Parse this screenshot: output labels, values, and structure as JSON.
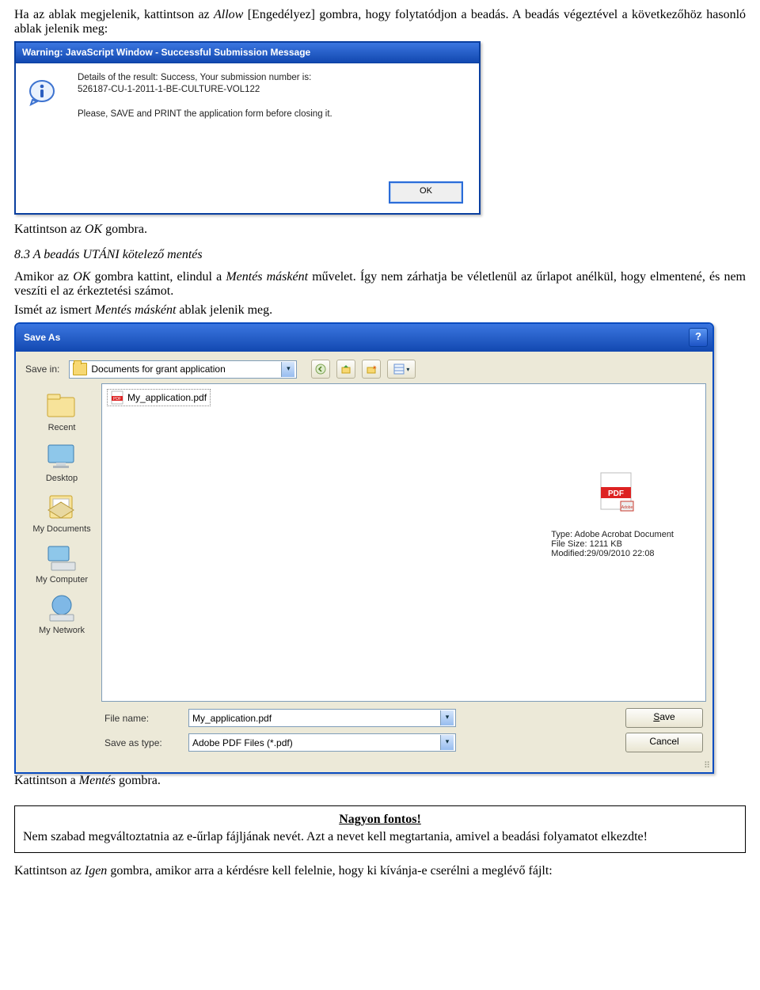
{
  "doc": {
    "p1a": "Ha az ablak megjelenik, kattintson az ",
    "p1b": "Allow",
    "p1c": " [Engedélyez] gombra, hogy folytatódjon a beadás. A beadás végeztével a következőhöz hasonló ablak jelenik meg:",
    "p2a": "Kattintson az ",
    "p2b": "OK",
    "p2c": " gombra.",
    "section": "8.3 A beadás UTÁNI kötelező mentés",
    "p3a": "Amikor az ",
    "p3b": "OK",
    "p3c": " gombra kattint, elindul a ",
    "p3d": "Mentés másként",
    "p3e": " művelet. Így nem zárhatja be véletlenül az űrlapot anélkül, hogy elmentené, és nem veszíti el az érkeztetési számot.",
    "p4a": "Ismét az ismert ",
    "p4b": "Mentés másként",
    "p4c": " ablak jelenik meg.",
    "p5a": "Kattintson a ",
    "p5b": "Mentés",
    "p5c": " gombra.",
    "noticeTitle": "Nagyon fontos!",
    "notice": "Nem szabad megváltoztatnia az e-űrlap fájljának nevét. Azt a nevet kell megtartania, amivel a beadási folyamatot elkezdte!",
    "p6a": "Kattintson az ",
    "p6b": "Igen",
    "p6c": " gombra, amikor arra a kérdésre kell felelnie, hogy ki kívánja-e cserélni a meglévő fájlt:"
  },
  "warn": {
    "title": "Warning: JavaScript Window - Successful Submission Message",
    "t1": "Details of the result: Success, Your submission number is:",
    "t2": "526187-CU-1-2011-1-BE-CULTURE-VOL122",
    "t3": "Please, SAVE and PRINT the application form before closing it.",
    "ok": "OK"
  },
  "saveas": {
    "title": "Save As",
    "help": "?",
    "saveInLabel": "Save in:",
    "saveInValue": "Documents for grant application",
    "places": {
      "recent": "Recent",
      "desktop": "Desktop",
      "mydocs": "My Documents",
      "mycomputer": "My Computer",
      "mynetwork": "My Network"
    },
    "fileBadge": "My_application.pdf",
    "tooltip": {
      "type": "Type: Adobe Acrobat Document",
      "size": "File Size: 1211 KB",
      "mod": "Modified:29/09/2010 22:08"
    },
    "filenameLabel": "File name:",
    "filenameValue": "My_application.pdf",
    "typeLabel": "Save as type:",
    "typeValue": "Adobe PDF Files (*.pdf)",
    "saveBtn": "Save",
    "cancelBtn": "Cancel"
  }
}
